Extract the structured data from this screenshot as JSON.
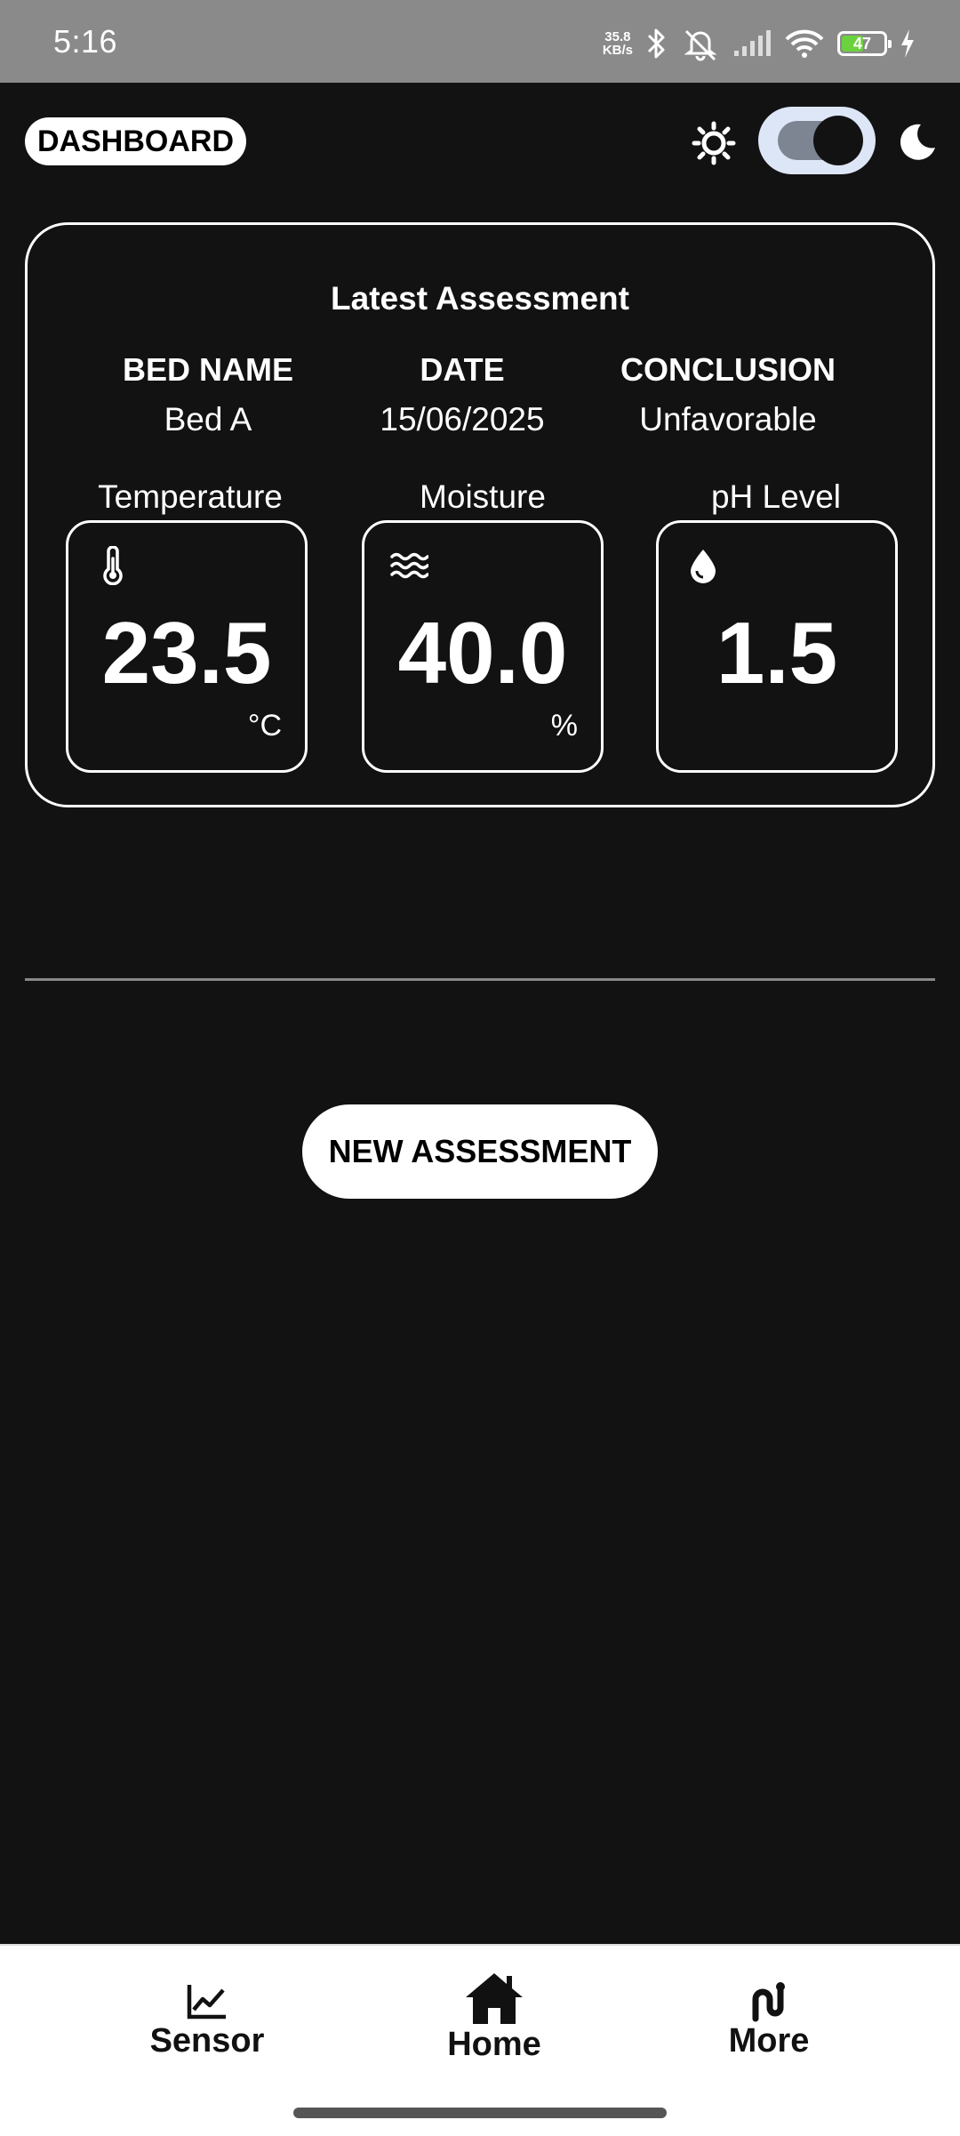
{
  "status_bar": {
    "time": "5:16",
    "net_speed_value": "35.8",
    "net_speed_unit": "KB/s",
    "battery_level": "47",
    "icons": [
      "bluetooth-icon",
      "bell-off-icon",
      "signal-icon",
      "wifi-icon",
      "battery-icon",
      "charging-icon"
    ]
  },
  "header": {
    "title": "DASHBOARD",
    "theme_toggle_on": true,
    "icons": [
      "sun-icon",
      "moon-icon"
    ]
  },
  "assessment": {
    "title": "Latest Assessment",
    "bed_name_header": "BED NAME",
    "bed_name": "Bed A",
    "date_header": "DATE",
    "date": "15/06/2025",
    "conclusion_header": "CONCLUSION",
    "conclusion": "Unfavorable",
    "metrics": [
      {
        "label": "Temperature",
        "value": "23.5",
        "unit": "°C",
        "icon": "thermometer-icon"
      },
      {
        "label": "Moisture",
        "value": "40.0",
        "unit": "%",
        "icon": "waves-icon"
      },
      {
        "label": "pH Level",
        "value": "1.5",
        "unit": "",
        "icon": "water-drop-icon"
      }
    ]
  },
  "actions": {
    "new_assessment": "NEW ASSESSMENT"
  },
  "nav": {
    "items": [
      {
        "label": "Sensor",
        "icon": "chart-line-icon"
      },
      {
        "label": "Home",
        "icon": "home-icon"
      },
      {
        "label": "More",
        "icon": "worm-icon"
      }
    ]
  },
  "colors": {
    "background": "#121212",
    "status_bar": "#8a8a8a",
    "toggle_bg": "#dde6f7",
    "battery_fill": "#6bd13e"
  }
}
